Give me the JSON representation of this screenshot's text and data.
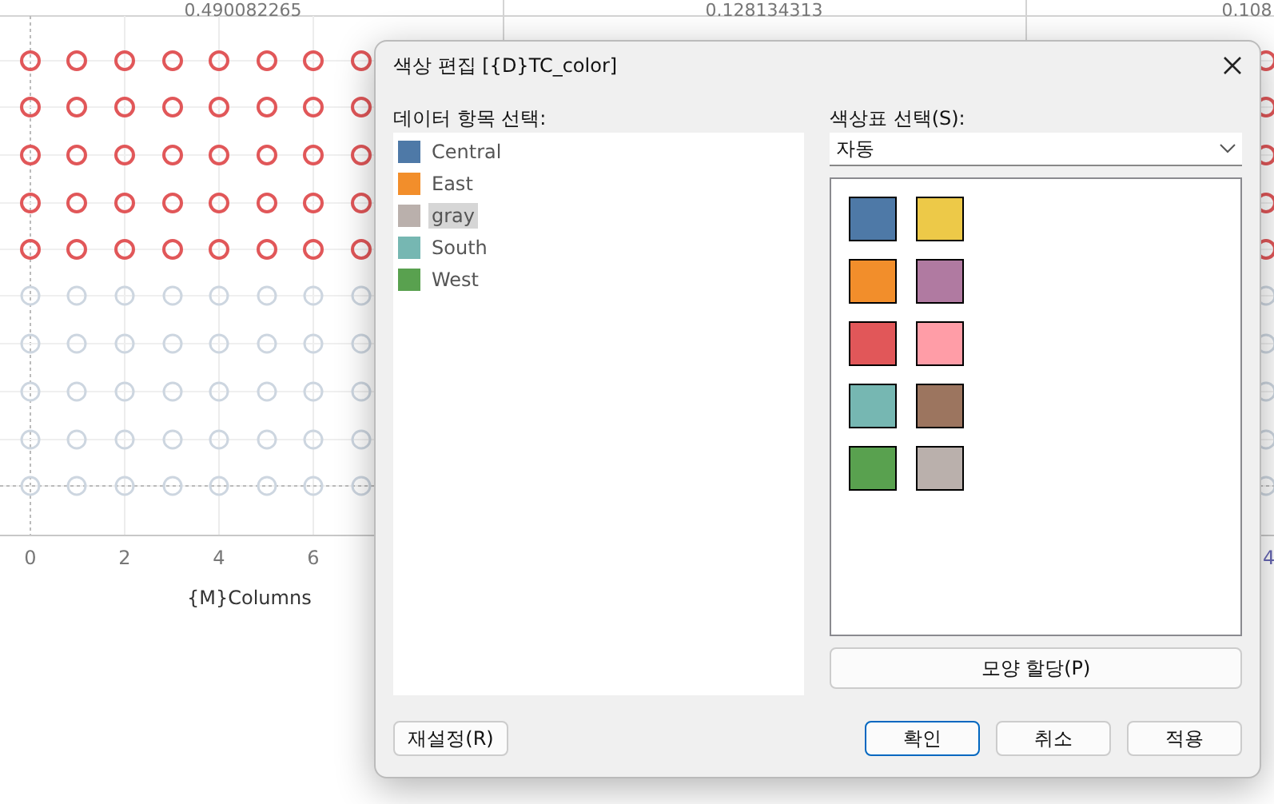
{
  "chart": {
    "header_values": [
      "0.490082265",
      "0.128134313",
      "0.108"
    ],
    "x_ticks": [
      "0",
      "2",
      "4",
      "6"
    ],
    "x_label": "{M}Columns",
    "right_tick": "4"
  },
  "dialog": {
    "title": "색상 편집 [{D}TC_color]",
    "data_items_label": "데이터 항목 선택:",
    "data_items": [
      {
        "label": "Central",
        "color": "#4e79a7",
        "selected": false
      },
      {
        "label": "East",
        "color": "#f28e2b",
        "selected": false
      },
      {
        "label": "gray",
        "color": "#bab0ac",
        "selected": true
      },
      {
        "label": "South",
        "color": "#76b7b2",
        "selected": false
      },
      {
        "label": "West",
        "color": "#59a14f",
        "selected": false
      }
    ],
    "palette_label": "색상표 선택(S):",
    "palette_value": "자동",
    "swatches": [
      {
        "color": "#4e79a7"
      },
      {
        "color": "#edc948"
      },
      {
        "color": "#f28e2b"
      },
      {
        "color": "#b07aa1"
      },
      {
        "color": "#e15759"
      },
      {
        "color": "#ff9da7"
      },
      {
        "color": "#76b7b2"
      },
      {
        "color": "#9c755f"
      },
      {
        "color": "#59a14f"
      },
      {
        "color": "#bab0ac"
      }
    ],
    "assign_shape_button": "모양 할당(P)",
    "reset_button": "재설정(R)",
    "buttons": [
      {
        "label": "확인",
        "default": true
      },
      {
        "label": "취소",
        "default": false
      },
      {
        "label": "적용",
        "default": false
      }
    ]
  }
}
